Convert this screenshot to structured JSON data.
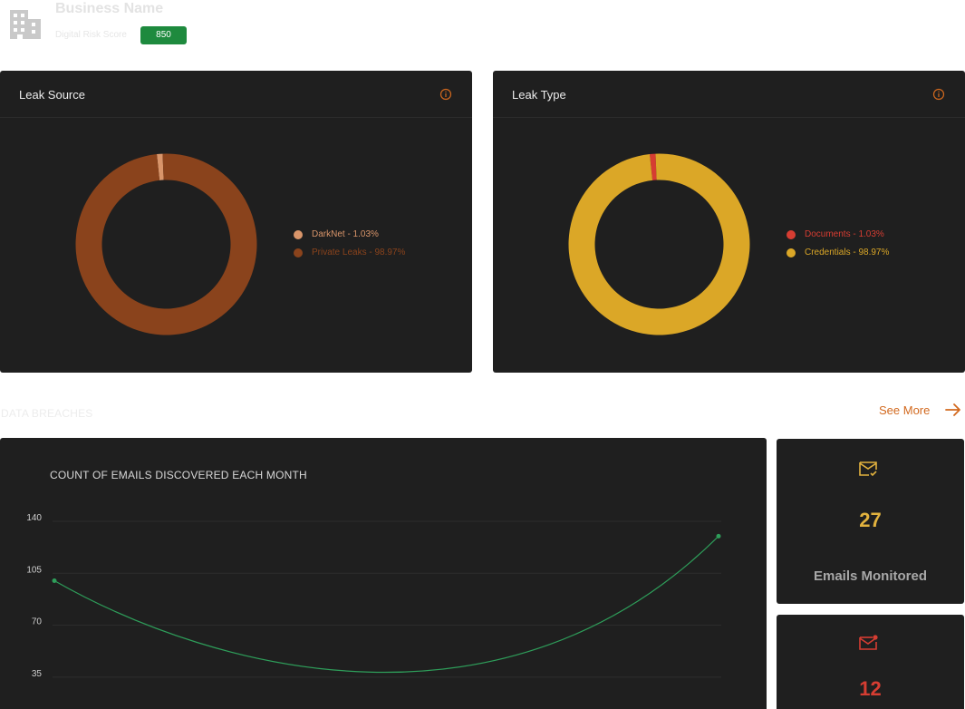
{
  "header": {
    "business_name": "Business Name",
    "risk_label": "Digital Risk Score",
    "risk_score": "850",
    "icon": "building-icon"
  },
  "leak_source": {
    "title": "Leak Source",
    "icon": "info-icon",
    "slices": [
      {
        "label": "DarkNet - 1.03%",
        "percent": 1.03,
        "color": "#d9956a"
      },
      {
        "label": "Private Leaks - 98.97%",
        "percent": 98.97,
        "color": "#8a431c"
      }
    ]
  },
  "leak_type": {
    "title": "Leak Type",
    "icon": "info-icon",
    "slices": [
      {
        "label": "Documents - 1.03%",
        "percent": 1.03,
        "color": "#d63d32"
      },
      {
        "label": "Credentials - 98.97%",
        "percent": 98.97,
        "color": "#dba727"
      }
    ]
  },
  "breaches": {
    "section_label": "DATA BREACHES",
    "see_more": "See More"
  },
  "chart_data": {
    "type": "line",
    "title": "COUNT OF EMAILS DISCOVERED EACH MONTH",
    "yticks": [
      "140",
      "105",
      "70",
      "35"
    ],
    "ylim": [
      0,
      140
    ],
    "series": [
      {
        "values": [
          100,
          130
        ],
        "color": "#2e9e5a"
      }
    ],
    "grid": true
  },
  "stats": [
    {
      "value": "27",
      "label": "Emails Monitored",
      "icon": "mail-check-icon",
      "color": "#e2b23e"
    },
    {
      "value": "12",
      "label": "",
      "icon": "mail-alert-icon",
      "color": "#d63d32"
    }
  ],
  "colors": {
    "card_bg": "#1f1f1f",
    "accent": "#d2691e"
  }
}
